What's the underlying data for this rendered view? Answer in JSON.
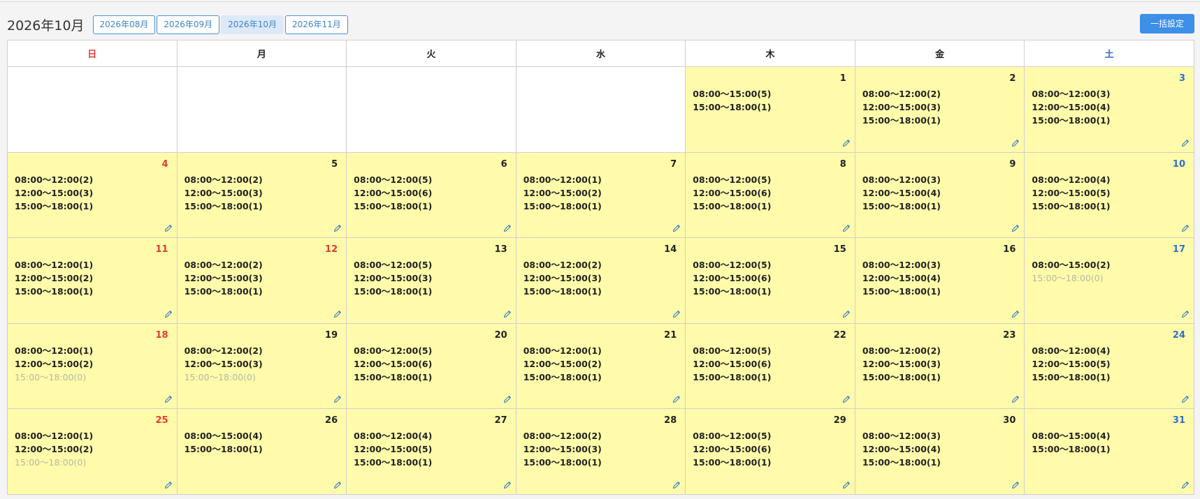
{
  "header": {
    "title": "2026年10月",
    "months": [
      "2026年08月",
      "2026年09月",
      "2026年10月",
      "2026年11月"
    ],
    "active_month_index": 2,
    "bulk_button": "一括設定"
  },
  "weekdays": [
    "日",
    "月",
    "火",
    "水",
    "木",
    "金",
    "土"
  ],
  "colors": {
    "sunday": "#e53935",
    "saturday": "#2e6fd1",
    "cell_fill": "#fffbaa",
    "accent": "#3d8fe8"
  },
  "weeks": [
    [
      null,
      null,
      null,
      null,
      {
        "day": "1",
        "slots": [
          {
            "text": "08:00〜15:00(5)",
            "disabled": false
          },
          {
            "text": "15:00〜18:00(1)",
            "disabled": false
          }
        ]
      },
      {
        "day": "2",
        "slots": [
          {
            "text": "08:00〜12:00(2)",
            "disabled": false
          },
          {
            "text": "12:00〜15:00(3)",
            "disabled": false
          },
          {
            "text": "15:00〜18:00(1)",
            "disabled": false
          }
        ]
      },
      {
        "day": "3",
        "color": "blue",
        "slots": [
          {
            "text": "08:00〜12:00(3)",
            "disabled": false
          },
          {
            "text": "12:00〜15:00(4)",
            "disabled": false
          },
          {
            "text": "15:00〜18:00(1)",
            "disabled": false
          }
        ]
      }
    ],
    [
      {
        "day": "4",
        "color": "red",
        "slots": [
          {
            "text": "08:00〜12:00(2)",
            "disabled": false
          },
          {
            "text": "12:00〜15:00(3)",
            "disabled": false
          },
          {
            "text": "15:00〜18:00(1)",
            "disabled": false
          }
        ]
      },
      {
        "day": "5",
        "slots": [
          {
            "text": "08:00〜12:00(2)",
            "disabled": false
          },
          {
            "text": "12:00〜15:00(3)",
            "disabled": false
          },
          {
            "text": "15:00〜18:00(1)",
            "disabled": false
          }
        ]
      },
      {
        "day": "6",
        "slots": [
          {
            "text": "08:00〜12:00(5)",
            "disabled": false
          },
          {
            "text": "12:00〜15:00(6)",
            "disabled": false
          },
          {
            "text": "15:00〜18:00(1)",
            "disabled": false
          }
        ]
      },
      {
        "day": "7",
        "slots": [
          {
            "text": "08:00〜12:00(1)",
            "disabled": false
          },
          {
            "text": "12:00〜15:00(2)",
            "disabled": false
          },
          {
            "text": "15:00〜18:00(1)",
            "disabled": false
          }
        ]
      },
      {
        "day": "8",
        "slots": [
          {
            "text": "08:00〜12:00(5)",
            "disabled": false
          },
          {
            "text": "12:00〜15:00(6)",
            "disabled": false
          },
          {
            "text": "15:00〜18:00(1)",
            "disabled": false
          }
        ]
      },
      {
        "day": "9",
        "slots": [
          {
            "text": "08:00〜12:00(3)",
            "disabled": false
          },
          {
            "text": "12:00〜15:00(4)",
            "disabled": false
          },
          {
            "text": "15:00〜18:00(1)",
            "disabled": false
          }
        ]
      },
      {
        "day": "10",
        "color": "blue",
        "slots": [
          {
            "text": "08:00〜12:00(4)",
            "disabled": false
          },
          {
            "text": "12:00〜15:00(5)",
            "disabled": false
          },
          {
            "text": "15:00〜18:00(1)",
            "disabled": false
          }
        ]
      }
    ],
    [
      {
        "day": "11",
        "color": "red",
        "slots": [
          {
            "text": "08:00〜12:00(1)",
            "disabled": false
          },
          {
            "text": "12:00〜15:00(2)",
            "disabled": false
          },
          {
            "text": "15:00〜18:00(1)",
            "disabled": false
          }
        ]
      },
      {
        "day": "12",
        "color": "red",
        "slots": [
          {
            "text": "08:00〜12:00(2)",
            "disabled": false
          },
          {
            "text": "12:00〜15:00(3)",
            "disabled": false
          },
          {
            "text": "15:00〜18:00(1)",
            "disabled": false
          }
        ]
      },
      {
        "day": "13",
        "slots": [
          {
            "text": "08:00〜12:00(5)",
            "disabled": false
          },
          {
            "text": "12:00〜15:00(3)",
            "disabled": false
          },
          {
            "text": "15:00〜18:00(1)",
            "disabled": false
          }
        ]
      },
      {
        "day": "14",
        "slots": [
          {
            "text": "08:00〜12:00(2)",
            "disabled": false
          },
          {
            "text": "12:00〜15:00(3)",
            "disabled": false
          },
          {
            "text": "15:00〜18:00(1)",
            "disabled": false
          }
        ]
      },
      {
        "day": "15",
        "slots": [
          {
            "text": "08:00〜12:00(5)",
            "disabled": false
          },
          {
            "text": "12:00〜15:00(6)",
            "disabled": false
          },
          {
            "text": "15:00〜18:00(1)",
            "disabled": false
          }
        ]
      },
      {
        "day": "16",
        "slots": [
          {
            "text": "08:00〜12:00(3)",
            "disabled": false
          },
          {
            "text": "12:00〜15:00(4)",
            "disabled": false
          },
          {
            "text": "15:00〜18:00(1)",
            "disabled": false
          }
        ]
      },
      {
        "day": "17",
        "color": "blue",
        "slots": [
          {
            "text": "08:00〜15:00(2)",
            "disabled": false
          },
          {
            "text": "15:00〜18:00(0)",
            "disabled": true
          }
        ]
      }
    ],
    [
      {
        "day": "18",
        "color": "red",
        "slots": [
          {
            "text": "08:00〜12:00(1)",
            "disabled": false
          },
          {
            "text": "12:00〜15:00(2)",
            "disabled": false
          },
          {
            "text": "15:00〜18:00(0)",
            "disabled": true
          }
        ]
      },
      {
        "day": "19",
        "slots": [
          {
            "text": "08:00〜12:00(2)",
            "disabled": false
          },
          {
            "text": "12:00〜15:00(3)",
            "disabled": false
          },
          {
            "text": "15:00〜18:00(0)",
            "disabled": true
          }
        ]
      },
      {
        "day": "20",
        "slots": [
          {
            "text": "08:00〜12:00(5)",
            "disabled": false
          },
          {
            "text": "12:00〜15:00(6)",
            "disabled": false
          },
          {
            "text": "15:00〜18:00(1)",
            "disabled": false
          }
        ]
      },
      {
        "day": "21",
        "slots": [
          {
            "text": "08:00〜12:00(1)",
            "disabled": false
          },
          {
            "text": "12:00〜15:00(2)",
            "disabled": false
          },
          {
            "text": "15:00〜18:00(1)",
            "disabled": false
          }
        ]
      },
      {
        "day": "22",
        "slots": [
          {
            "text": "08:00〜12:00(5)",
            "disabled": false
          },
          {
            "text": "12:00〜15:00(6)",
            "disabled": false
          },
          {
            "text": "15:00〜18:00(1)",
            "disabled": false
          }
        ]
      },
      {
        "day": "23",
        "slots": [
          {
            "text": "08:00〜12:00(2)",
            "disabled": false
          },
          {
            "text": "12:00〜15:00(3)",
            "disabled": false
          },
          {
            "text": "15:00〜18:00(1)",
            "disabled": false
          }
        ]
      },
      {
        "day": "24",
        "color": "blue",
        "slots": [
          {
            "text": "08:00〜12:00(4)",
            "disabled": false
          },
          {
            "text": "12:00〜15:00(5)",
            "disabled": false
          },
          {
            "text": "15:00〜18:00(1)",
            "disabled": false
          }
        ]
      }
    ],
    [
      {
        "day": "25",
        "color": "red",
        "slots": [
          {
            "text": "08:00〜12:00(1)",
            "disabled": false
          },
          {
            "text": "12:00〜15:00(2)",
            "disabled": false
          },
          {
            "text": "15:00〜18:00(0)",
            "disabled": true
          }
        ]
      },
      {
        "day": "26",
        "slots": [
          {
            "text": "08:00〜15:00(4)",
            "disabled": false
          },
          {
            "text": "15:00〜18:00(1)",
            "disabled": false
          }
        ]
      },
      {
        "day": "27",
        "slots": [
          {
            "text": "08:00〜12:00(4)",
            "disabled": false
          },
          {
            "text": "12:00〜15:00(5)",
            "disabled": false
          },
          {
            "text": "15:00〜18:00(1)",
            "disabled": false
          }
        ]
      },
      {
        "day": "28",
        "slots": [
          {
            "text": "08:00〜12:00(2)",
            "disabled": false
          },
          {
            "text": "12:00〜15:00(3)",
            "disabled": false
          },
          {
            "text": "15:00〜18:00(1)",
            "disabled": false
          }
        ]
      },
      {
        "day": "29",
        "slots": [
          {
            "text": "08:00〜12:00(5)",
            "disabled": false
          },
          {
            "text": "12:00〜15:00(6)",
            "disabled": false
          },
          {
            "text": "15:00〜18:00(1)",
            "disabled": false
          }
        ]
      },
      {
        "day": "30",
        "slots": [
          {
            "text": "08:00〜12:00(3)",
            "disabled": false
          },
          {
            "text": "12:00〜15:00(4)",
            "disabled": false
          },
          {
            "text": "15:00〜18:00(1)",
            "disabled": false
          }
        ]
      },
      {
        "day": "31",
        "color": "blue",
        "slots": [
          {
            "text": "08:00〜15:00(4)",
            "disabled": false
          },
          {
            "text": "15:00〜18:00(1)",
            "disabled": false
          }
        ]
      }
    ]
  ]
}
